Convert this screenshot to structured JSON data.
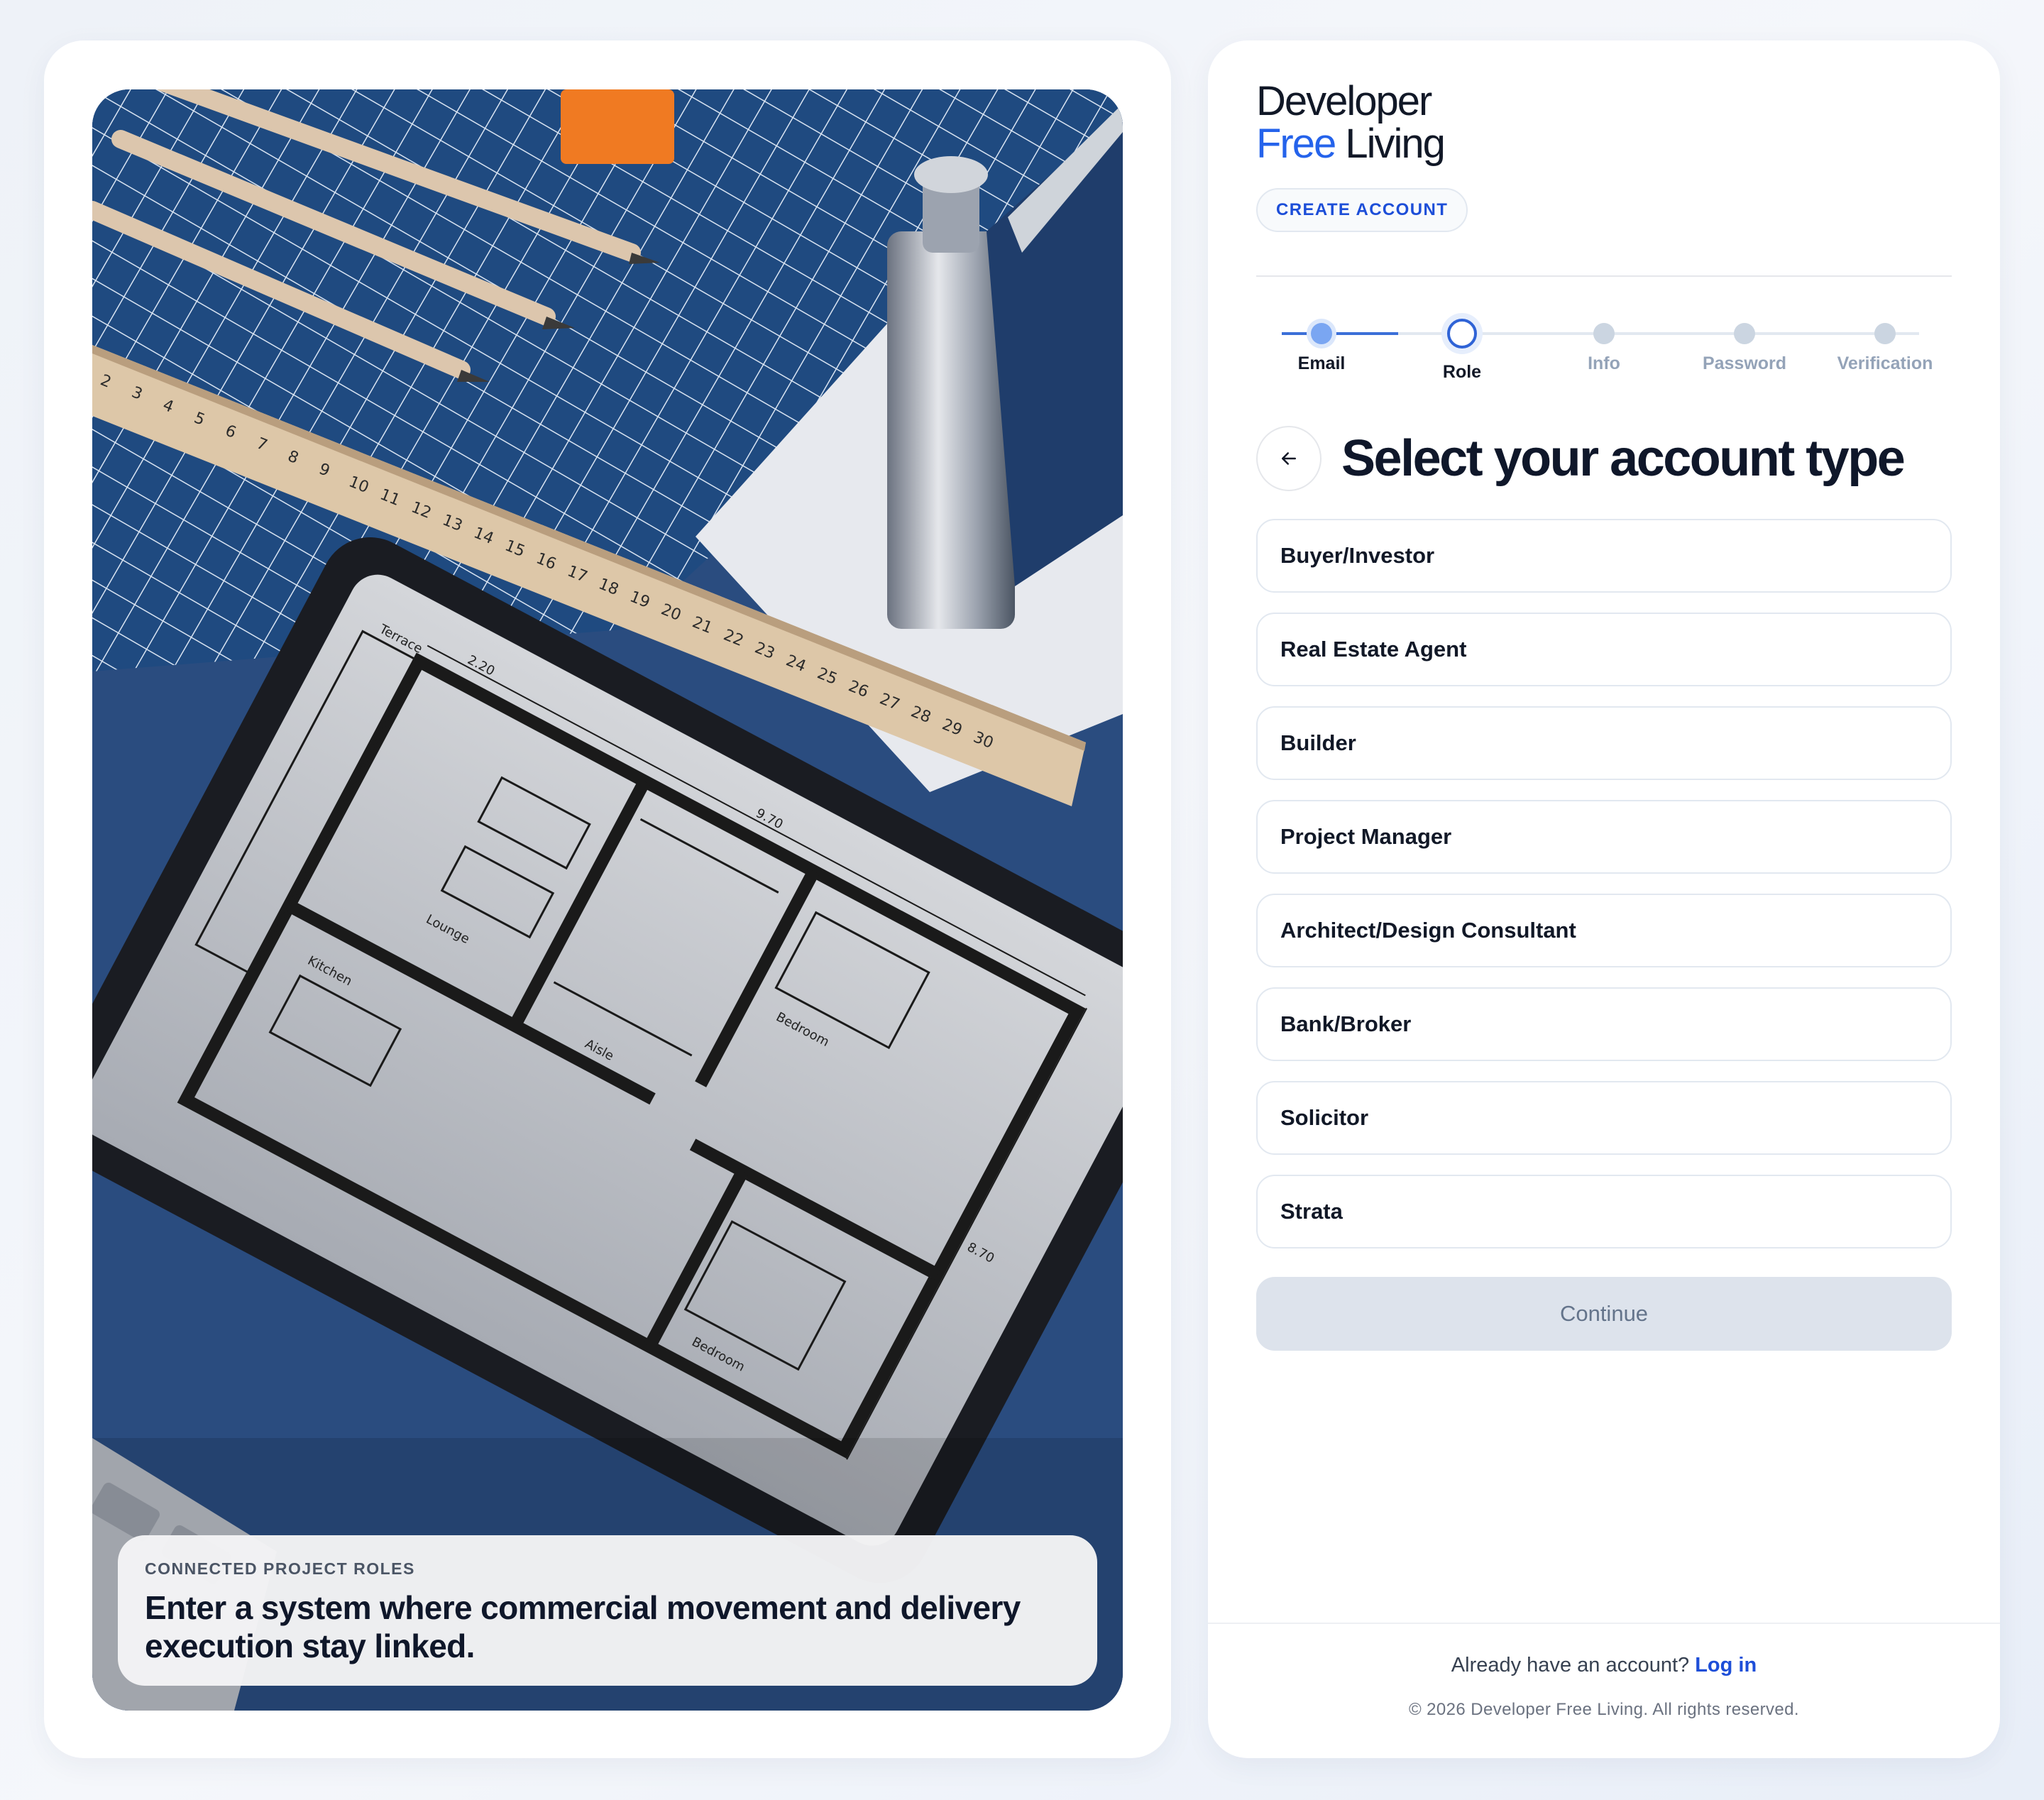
{
  "hero": {
    "caption_kicker": "CONNECTED PROJECT ROLES",
    "caption_text": "Enter a system where commercial movement and delivery execution stay linked.",
    "ruler_numbers": [
      "2",
      "3",
      "4",
      "5",
      "6",
      "7",
      "8",
      "9",
      "10",
      "11",
      "12",
      "13",
      "14",
      "15",
      "16",
      "17",
      "18",
      "19",
      "20",
      "21",
      "22",
      "23",
      "24",
      "25",
      "26",
      "27",
      "28",
      "29",
      "30"
    ],
    "plan_labels": {
      "lounge": "Lounge",
      "kitchen": "Kitchen",
      "bedroom1": "Bedroom",
      "bedroom2": "Bedroom",
      "aisle": "Aisle",
      "terrace": "Terrace",
      "dim1": "2.20",
      "dim2": "9.70",
      "dim3": "8.70"
    }
  },
  "brand": {
    "line1": "Developer",
    "line2_accent": "Free",
    "line2_rest": " Living"
  },
  "header": {
    "pill_label": "CREATE ACCOUNT"
  },
  "stepper": {
    "steps": [
      {
        "label": "Email",
        "state": "done"
      },
      {
        "label": "Role",
        "state": "current"
      },
      {
        "label": "Info",
        "state": "todo"
      },
      {
        "label": "Password",
        "state": "todo"
      },
      {
        "label": "Verification",
        "state": "todo"
      }
    ]
  },
  "main": {
    "back_icon": "arrow-left-icon",
    "title": "Select your account type",
    "options": [
      "Buyer/Investor",
      "Real Estate Agent",
      "Builder",
      "Project Manager",
      "Architect/Design Consultant",
      "Bank/Broker",
      "Solicitor",
      "Strata"
    ],
    "continue_label": "Continue"
  },
  "footer": {
    "login_prompt": "Already have an account?",
    "login_link": "Log in",
    "copyright": "© 2026 Developer Free Living. All rights reserved."
  },
  "colors": {
    "accent": "#2563eb",
    "primary_text": "#0f172a",
    "disabled_button": "#dde3ec"
  }
}
